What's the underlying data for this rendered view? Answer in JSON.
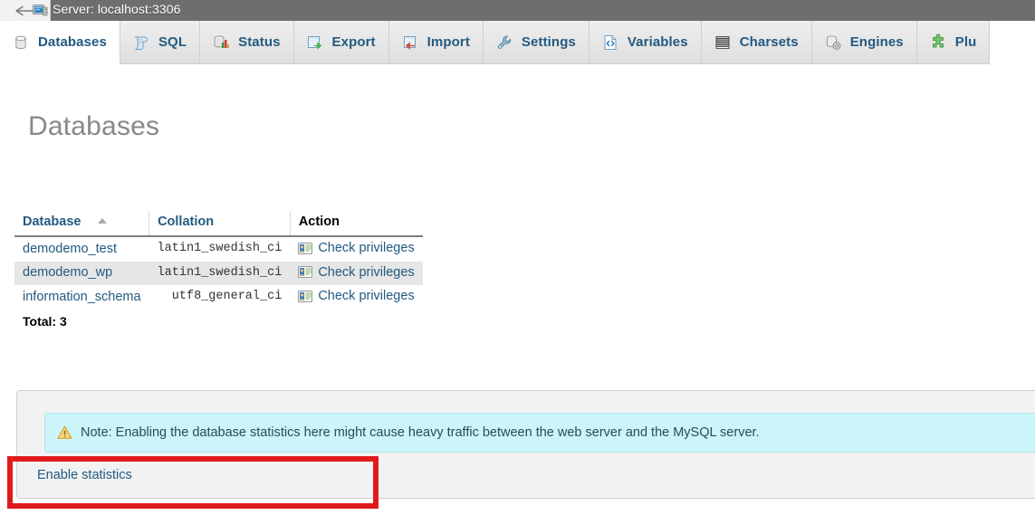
{
  "window": {
    "back_icon": "back-arrow-icon",
    "server_icon": "server-computer-icon",
    "server_label": "Server: localhost:3306"
  },
  "tabs": [
    {
      "label": "Databases",
      "icon": "database-icon",
      "active": true
    },
    {
      "label": "SQL",
      "icon": "sql-scroll-icon",
      "active": false
    },
    {
      "label": "Status",
      "icon": "status-icon",
      "active": false
    },
    {
      "label": "Export",
      "icon": "export-icon",
      "active": false
    },
    {
      "label": "Import",
      "icon": "import-icon",
      "active": false
    },
    {
      "label": "Settings",
      "icon": "wrench-icon",
      "active": false
    },
    {
      "label": "Variables",
      "icon": "code-file-icon",
      "active": false
    },
    {
      "label": "Charsets",
      "icon": "charsets-icon",
      "active": false
    },
    {
      "label": "Engines",
      "icon": "engines-icon",
      "active": false
    },
    {
      "label": "Plu",
      "icon": "plugins-icon",
      "active": false
    }
  ],
  "page": {
    "title": "Databases"
  },
  "table": {
    "columns": [
      "Database",
      "Collation",
      "Action"
    ],
    "sort_column": "Database",
    "sort_direction": "ascending",
    "rows": [
      {
        "database": "demodemo_test",
        "collation": "latin1_swedish_ci",
        "action": "Check privileges",
        "action_icon": "privileges-card-icon"
      },
      {
        "database": "demodemo_wp",
        "collation": "latin1_swedish_ci",
        "action": "Check privileges",
        "action_icon": "privileges-card-icon"
      },
      {
        "database": "information_schema",
        "collation": "utf8_general_ci",
        "action": "Check privileges",
        "action_icon": "privileges-card-icon"
      }
    ],
    "total_label": "Total: 3"
  },
  "panel": {
    "note_icon": "warning-triangle-icon",
    "note_text": "Note: Enabling the database statistics here might cause heavy traffic between the web server and the MySQL server.",
    "enable_link": "Enable statistics"
  },
  "annotation": {
    "highlight_color": "#e01b1b",
    "target": "enable-statistics-link"
  },
  "colors": {
    "tab_text": "#235a81",
    "title_text": "#888888",
    "note_bg": "#ccf4fb",
    "panel_bg": "#f2f2f2",
    "serverbar_bg": "#6e6e6e",
    "row_alt_bg": "#e6e6e6"
  }
}
